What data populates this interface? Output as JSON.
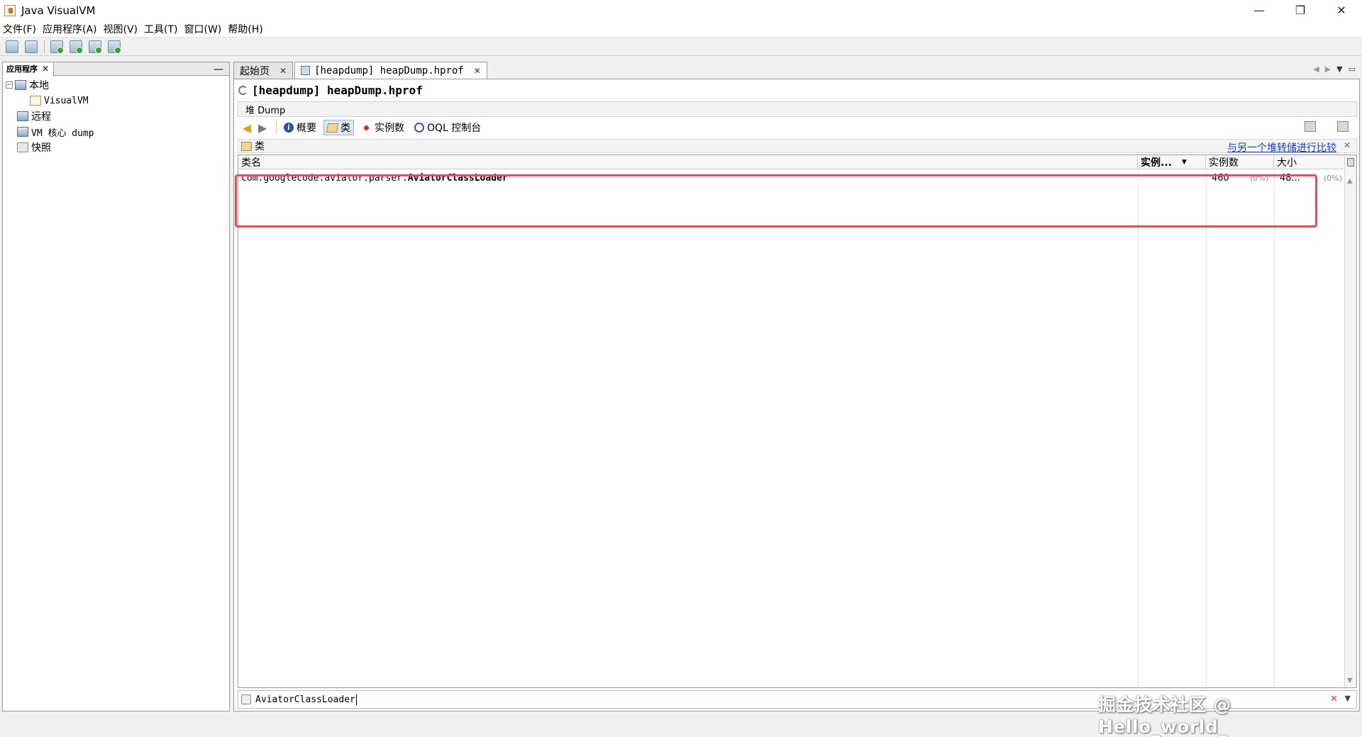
{
  "window": {
    "title": "Java VisualVM",
    "controls": {
      "minimize": "—",
      "restore": "❐",
      "close": "✕"
    }
  },
  "menu": [
    "文件(F)",
    "应用程序(A)",
    "视图(V)",
    "工具(T)",
    "窗口(W)",
    "帮助(H)"
  ],
  "left_panel": {
    "tab": "应用程序",
    "tree": [
      {
        "label": "本地",
        "expander": "−"
      },
      {
        "label": "VisualVM"
      },
      {
        "label": "远程"
      },
      {
        "label": "VM 核心 dump"
      },
      {
        "label": "快照"
      }
    ]
  },
  "doc_tabs": [
    {
      "label": "起始页",
      "active": false
    },
    {
      "label": "[heapdump] heapDump.hprof",
      "active": true
    }
  ],
  "document": {
    "title": "[heapdump] heapDump.hprof",
    "subtab": "堆 Dump",
    "views": {
      "summary": "概要",
      "classes": "类",
      "instances": "实例数",
      "oql": "OQL 控制台"
    },
    "classes_header": "类",
    "compare_link": "与另一个堆转储进行比较",
    "table": {
      "columns": {
        "name": "类名",
        "instances_sort": "实例...",
        "instances": "实例数",
        "size": "大小"
      },
      "rows": [
        {
          "class_prefix": "com.googlecode.aviator.parser.",
          "class_name": "AviatorClassLoader",
          "instances": "460",
          "instances_pct": "(0%)",
          "size": "48...",
          "size_pct": "(0%)"
        }
      ]
    },
    "filter_value": "AviatorClassLoader"
  },
  "watermark": "掘金技术社区 @ Hello_world_"
}
